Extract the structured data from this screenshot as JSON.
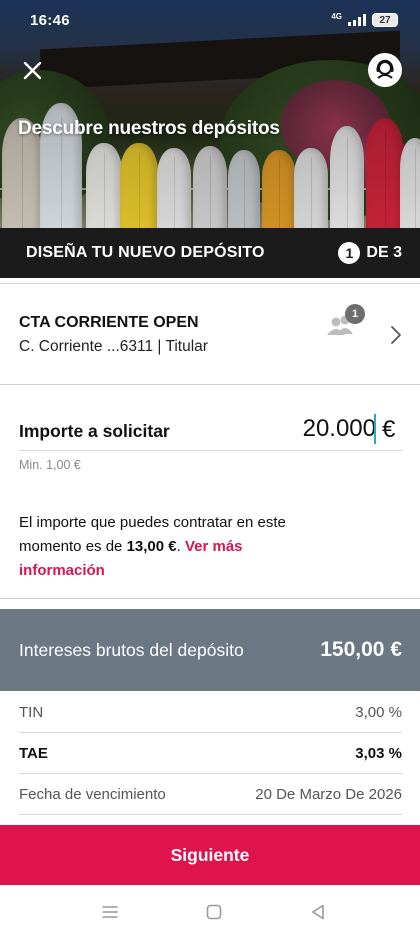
{
  "status_bar": {
    "time": "16:46",
    "network": "4G",
    "battery": "27"
  },
  "hero": {
    "title": "Descubre nuestros depósitos"
  },
  "stepbar": {
    "title": "DISEÑA TU NUEVO DEPÓSITO",
    "current": "1",
    "total": "DE 3"
  },
  "account": {
    "name": "CTA CORRIENTE OPEN",
    "detail": "C. Corriente ...6311 | Titular",
    "holders_count": "1"
  },
  "amount": {
    "label": "Importe a solicitar",
    "value": "20.000",
    "currency": "€",
    "min_hint": "Min. 1,00 €"
  },
  "info": {
    "text_before": "El importe que puedes contratar en este momento es de ",
    "amount": "13,00 €",
    "text_after": ". ",
    "link": "Ver más información"
  },
  "interest": {
    "label": "Intereses brutos del depósito",
    "value": "150,00 €"
  },
  "rows": [
    {
      "label": "TIN",
      "value": "3,00 %"
    },
    {
      "label": "TAE",
      "value": "3,03 %"
    },
    {
      "label": "Fecha de vencimiento",
      "value": "20 De Marzo De 2026"
    }
  ],
  "cta": {
    "label": "Siguiente"
  },
  "colors": {
    "primary": "#e0144c",
    "dark_bar": "#1b1b1b",
    "summary_bar": "#6c7784",
    "link": "#d6174f"
  },
  "icons": {
    "close": "close-icon",
    "avatar": "assistant-avatar-icon",
    "holders": "users-icon",
    "chevron": "chevron-right-icon",
    "nav_menu": "menu-icon",
    "nav_home": "home-square-icon",
    "nav_back": "back-triangle-icon"
  }
}
